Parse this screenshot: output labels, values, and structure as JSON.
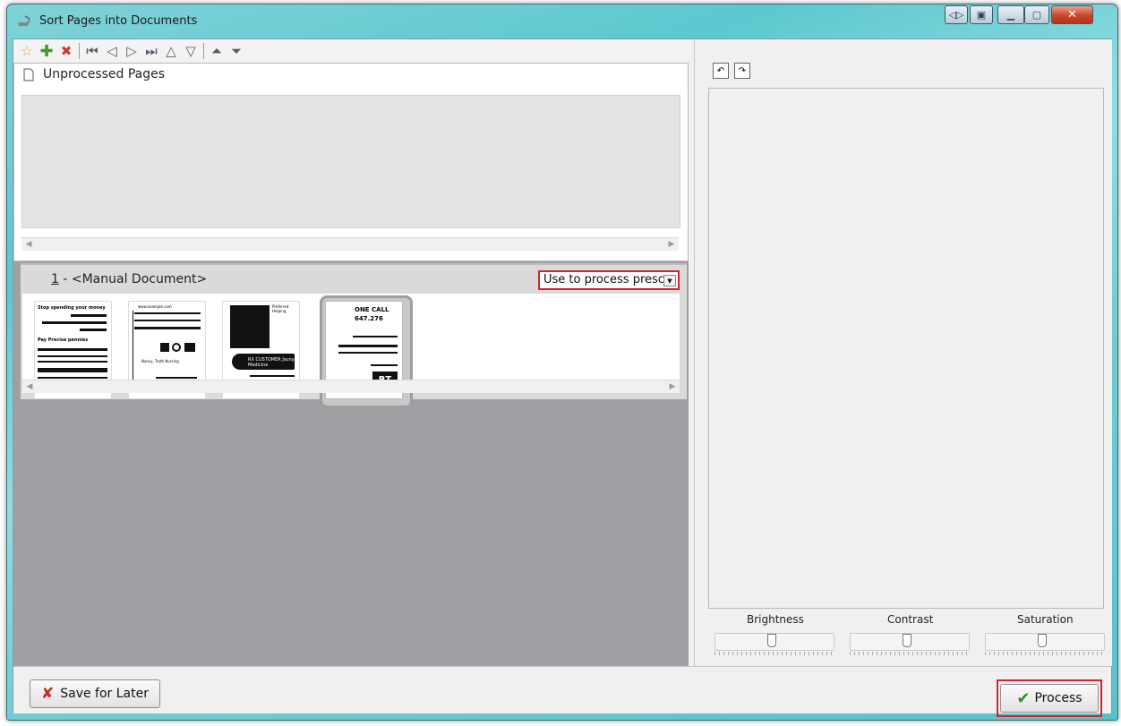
{
  "window": {
    "title": "Sort Pages into Documents"
  },
  "toolbar": {
    "icons": [
      "star-icon",
      "add-icon",
      "delete-icon",
      "first-icon",
      "prev-icon",
      "next-icon",
      "last-icon",
      "up-icon",
      "down-icon",
      "top-icon",
      "bottom-icon"
    ]
  },
  "unprocessed": {
    "title": "Unprocessed Pages"
  },
  "document": {
    "number": "1",
    "name": " - <Manual Document>",
    "select_value": "Use to process prescr"
  },
  "thumbnails": [
    {
      "heading": "Stop spending your money",
      "text": "Pay Precise pennies"
    },
    {
      "heading": "www.example.com",
      "text": "Nancy, Troth Nursing"
    },
    {
      "heading": "Preferred Helping",
      "text": "RX CUSTOMER Jsuny Medicine"
    },
    {
      "heading": "ONE CALL 647.276",
      "text": "BT"
    }
  ],
  "sliders": [
    {
      "label": "Brightness",
      "value": 0.5
    },
    {
      "label": "Contrast",
      "value": 0.5
    },
    {
      "label": "Saturation",
      "value": 0.5
    }
  ],
  "buttons": {
    "save_later": "Save for Later",
    "process": "Process"
  }
}
